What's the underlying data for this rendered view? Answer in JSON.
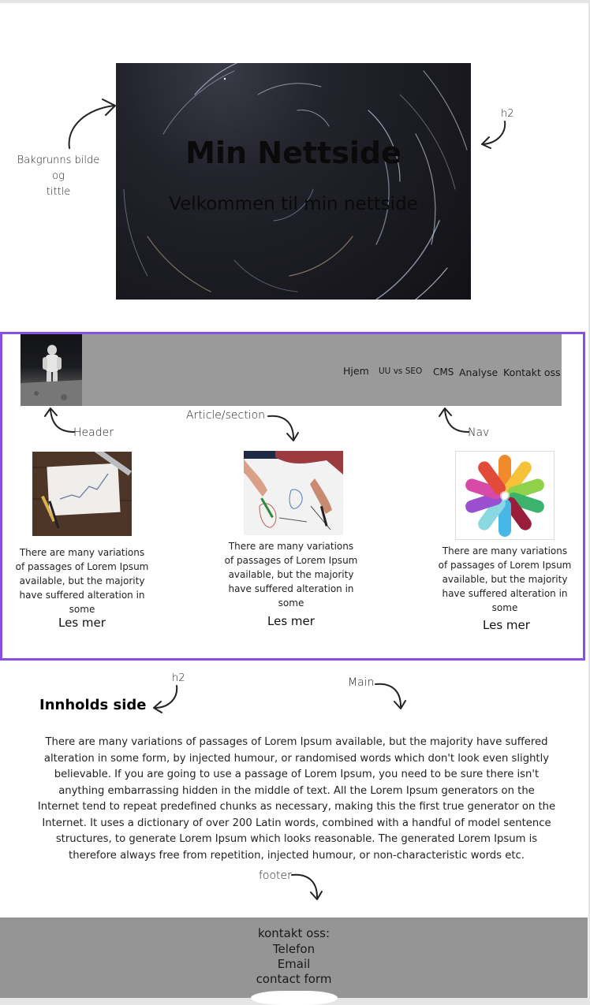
{
  "hero": {
    "title": "Min Nettside",
    "subtitle": "Velkommen til min nettside"
  },
  "annotations": {
    "bakgrunn_line1": "Bakgrunns bilde og",
    "bakgrunn_line2": "tittle",
    "h2_top": "h2",
    "header": "Header",
    "article_section": "Article/section",
    "nav": "Nav",
    "h2_content": "h2",
    "main": "Main",
    "footer": "footer"
  },
  "nav": {
    "items": [
      {
        "label": "Hjem"
      },
      {
        "label": "UU vs SEO"
      },
      {
        "label": "CMS"
      },
      {
        "label": "Analyse"
      },
      {
        "label": "Kontakt oss"
      }
    ]
  },
  "cards": [
    {
      "image": "desk-chart-photo",
      "text": "There are many variations of passages of Lorem Ipsum available, but the majority have suffered alteration in some",
      "link": "Les mer"
    },
    {
      "image": "drawing-hands-photo",
      "text": "There are many variations of passages of Lorem Ipsum available, but the majority have suffered alteration in some",
      "link": "Les mer"
    },
    {
      "image": "colorful-bandages-photo",
      "text": "There are many variations of passages of Lorem Ipsum available, but the majority have suffered alteration in some",
      "link": "Les mer"
    }
  ],
  "content": {
    "title": "Innholds side",
    "body": "There are many variations of passages of Lorem Ipsum available, but the majority have suffered alteration in some form, by injected humour, or randomised words which don't look even slightly believable. If you are going to use a passage of Lorem Ipsum, you need to be sure there isn't anything embarrassing hidden in the middle of text. All the Lorem Ipsum generators on the Internet tend to repeat predefined chunks as necessary, making this the first true generator on the Internet. It uses a dictionary of over 200 Latin words, combined with a handful of model sentence structures, to generate Lorem Ipsum which looks reasonable. The generated Lorem Ipsum is therefore always free from repetition, injected humour, or non-characteristic words etc."
  },
  "footer": {
    "heading": "kontakt oss:",
    "phone": "Telefon",
    "email": "Email",
    "form": "contact form"
  },
  "colors": {
    "frame": "#8a4fe8",
    "header_bar": "#9a9a9a",
    "footer_bg": "#959595"
  }
}
